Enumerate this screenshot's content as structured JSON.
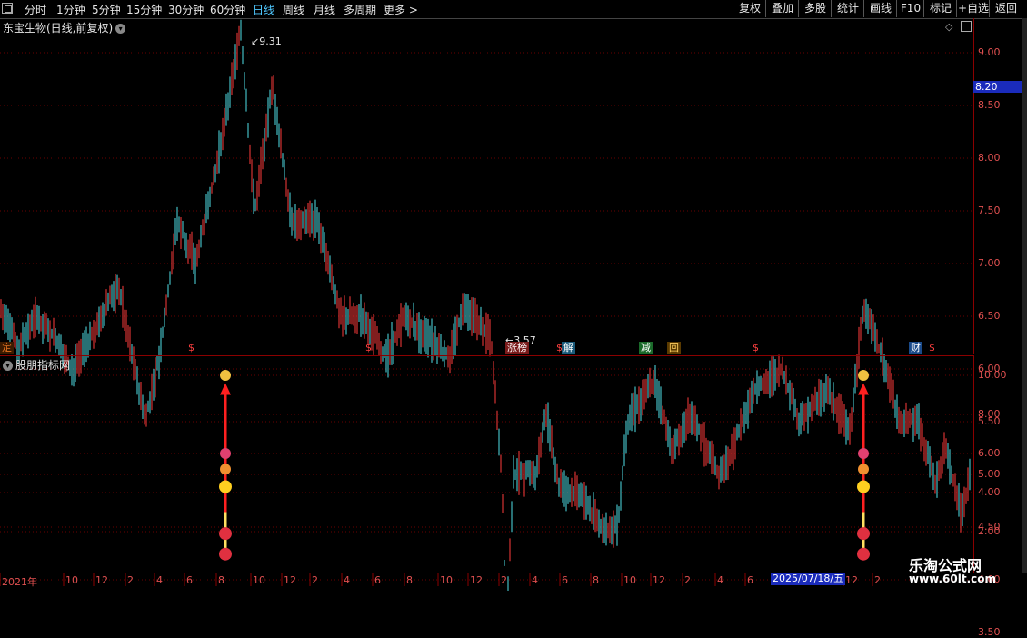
{
  "toolbar": {
    "periods": [
      {
        "label": "分时",
        "active": false
      },
      {
        "label": "1分钟",
        "active": false
      },
      {
        "label": "5分钟",
        "active": false
      },
      {
        "label": "15分钟",
        "active": false
      },
      {
        "label": "30分钟",
        "active": false
      },
      {
        "label": "60分钟",
        "active": false
      },
      {
        "label": "日线",
        "active": true
      },
      {
        "label": "周线",
        "active": false
      },
      {
        "label": "月线",
        "active": false
      },
      {
        "label": "多周期",
        "active": false
      },
      {
        "label": "更多 >",
        "active": false
      }
    ],
    "buttons": [
      "复权",
      "叠加",
      "多股",
      "统计",
      "画线",
      "F10",
      "标记",
      "+自选",
      "返回"
    ]
  },
  "main_chart": {
    "title": "东宝生物(日线,前复权)",
    "high_label": "9.31",
    "low_label": "3.57",
    "current_price": "8.20",
    "y_ticks": [
      "9.00",
      "8.50",
      "8.00",
      "7.50",
      "7.00",
      "6.50",
      "6.00",
      "5.50",
      "5.00",
      "4.50",
      "4.00",
      "3.50"
    ],
    "events": [
      {
        "label": "定",
        "color": "#e07020",
        "bg": "#3a1a00"
      },
      {
        "label": "$",
        "color": "#ff4040",
        "bg": "transparent"
      },
      {
        "label": "$",
        "color": "#ff4040",
        "bg": "transparent"
      },
      {
        "label": "涨榜",
        "color": "#ffffff",
        "bg": "#7a1a1a"
      },
      {
        "label": "$",
        "color": "#ff4040",
        "bg": "transparent"
      },
      {
        "label": "解",
        "color": "#ffffff",
        "bg": "#1a5a7a"
      },
      {
        "label": "减",
        "color": "#ffffff",
        "bg": "#1a6a2a"
      },
      {
        "label": "回",
        "color": "#ffd060",
        "bg": "#5a3a00"
      },
      {
        "label": "$",
        "color": "#ff4040",
        "bg": "transparent"
      },
      {
        "label": "财",
        "color": "#ffffff",
        "bg": "#1a4a8a"
      },
      {
        "label": "$",
        "color": "#ff4040",
        "bg": "transparent"
      }
    ]
  },
  "indicator": {
    "title": "股朋指标网",
    "y_ticks": [
      "10.00",
      "8.00",
      "6.00",
      "4.00",
      "2.00"
    ]
  },
  "date_axis": {
    "labels": [
      "2021年",
      "10",
      "12",
      "2",
      "4",
      "6",
      "8",
      "10",
      "12",
      "2",
      "4",
      "6",
      "8",
      "10",
      "12",
      "2",
      "4",
      "6",
      "8",
      "10",
      "12",
      "2",
      "4",
      "6",
      "12",
      "2"
    ],
    "selected_date": "2025/07/18/五"
  },
  "watermark": {
    "line1": "乐淘公式网",
    "line2": "www.60lt.com"
  },
  "colors": {
    "up": "#ff3b3b",
    "down": "#4fe0e8",
    "grid": "#6a0000",
    "axis_text": "#e05050",
    "selected": "#1a2bbb"
  },
  "icons": [
    "window-icon",
    "dropdown-icon",
    "money-bag-icon",
    "smiley-icon",
    "ball-icon"
  ]
}
